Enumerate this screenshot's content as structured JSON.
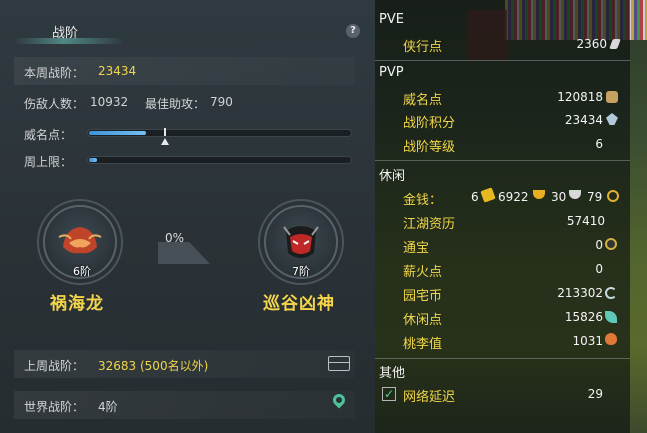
{
  "left_panel": {
    "title": "战阶",
    "help_symbol": "?",
    "weekly_label": "本周战阶：",
    "weekly_value": "23434",
    "damage_label": "伤敌人数：",
    "damage_value": "10932",
    "assist_label": "最佳助攻：",
    "assist_value": "790",
    "prestige_label": "威名点：",
    "prestige_progress": 0.22,
    "cap_label": "周上限：",
    "cap_progress": 0.03,
    "progress_pct": "0%",
    "current_rank": {
      "level": "6阶",
      "name": "祸海龙"
    },
    "next_rank": {
      "level": "7阶",
      "name": "巡谷凶神"
    },
    "last_week_label": "上周战阶：",
    "last_week_value": "32683 (500名以外)",
    "world_label": "世界战阶：",
    "world_value": "4阶"
  },
  "right_panel": {
    "pve_title": "PVE",
    "pve_items": [
      {
        "label": "侠行点",
        "value": "2360"
      }
    ],
    "pvp_title": "PVP",
    "pvp_items": [
      {
        "label": "威名点",
        "value": "120818"
      },
      {
        "label": "战阶积分",
        "value": "23434"
      },
      {
        "label": "战阶等级",
        "value": "6"
      }
    ],
    "leisure_title": "休闲",
    "money": {
      "label": "金钱：",
      "gold": "6",
      "silver": "6922",
      "copper": "30",
      "extra": "79"
    },
    "leisure_items": [
      {
        "label": "江湖资历",
        "value": "57410"
      },
      {
        "label": "通宝",
        "value": "0"
      },
      {
        "label": "薪火点",
        "value": "0"
      },
      {
        "label": "园宅币",
        "value": "213302"
      },
      {
        "label": "休闲点",
        "value": "15826"
      },
      {
        "label": "桃李值",
        "value": "1031"
      }
    ],
    "other_title": "其他",
    "other_items": [
      {
        "label": "网络延迟",
        "value": "29",
        "check": "✓"
      }
    ]
  },
  "colors": {
    "accent_yellow": "#f0d64a",
    "bar_blue": "#3d93d8",
    "panel_bg": "#2a3237"
  },
  "icons": [
    "help-icon",
    "chest-icon",
    "map-pin-icon",
    "ingot-icon",
    "coin-icon",
    "sword-icon",
    "swirl-icon",
    "gourd-icon",
    "check-icon"
  ]
}
